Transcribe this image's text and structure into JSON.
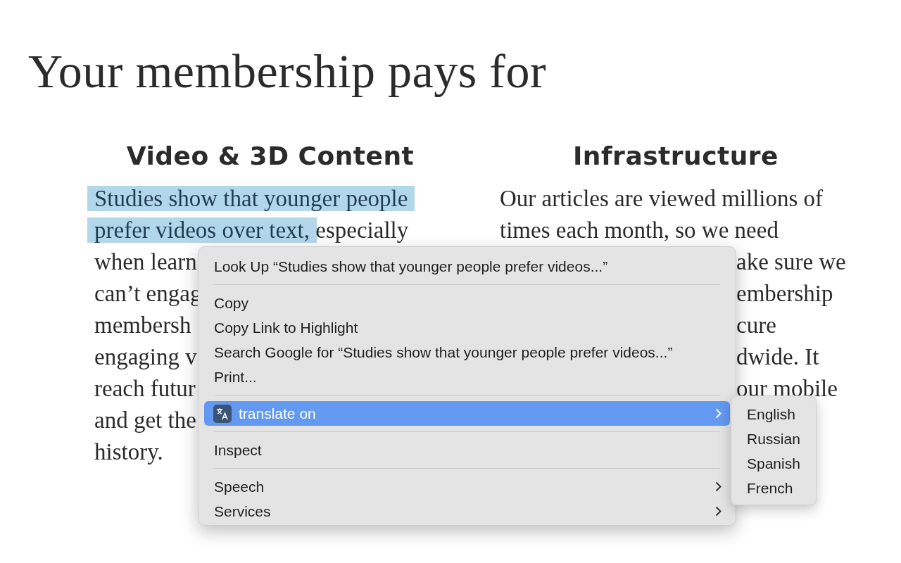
{
  "page": {
    "title": "Your membership pays for",
    "columns": [
      {
        "heading": "Video & 3D Content",
        "lines": [
          {
            "kind": "full",
            "segments": [
              {
                "text": "Studies show that younger people",
                "selected": true
              }
            ]
          },
          {
            "kind": "full",
            "segments": [
              {
                "text": "prefer videos over text,",
                "selected": true
              },
              {
                "text": " especially",
                "selected": false
              }
            ]
          },
          {
            "kind": "full",
            "segments": [
              {
                "text": "when learn",
                "selected": false
              }
            ]
          },
          {
            "kind": "full",
            "segments": [
              {
                "text": "can’t engag",
                "selected": false
              }
            ]
          },
          {
            "kind": "full",
            "segments": [
              {
                "text": "membersh",
                "selected": false
              }
            ]
          },
          {
            "kind": "full",
            "segments": [
              {
                "text": "engaging v",
                "selected": false
              }
            ]
          },
          {
            "kind": "full",
            "segments": [
              {
                "text": "reach futur",
                "selected": false
              }
            ]
          },
          {
            "kind": "full",
            "segments": [
              {
                "text": "and get the",
                "selected": false
              }
            ]
          },
          {
            "kind": "full",
            "segments": [
              {
                "text": "history.",
                "selected": false
              }
            ]
          }
        ]
      },
      {
        "heading": "Infrastructure",
        "lines": [
          {
            "kind": "full",
            "segments": [
              {
                "text": "Our articles are viewed millions of",
                "selected": false
              }
            ]
          },
          {
            "kind": "full",
            "segments": [
              {
                "text": "times each month, so we need",
                "selected": false
              }
            ]
          },
          {
            "kind": "cut",
            "segments": [
              {
                "text": "ake sure we",
                "selected": false
              }
            ]
          },
          {
            "kind": "cut",
            "segments": [
              {
                "text": "embership",
                "selected": false
              }
            ]
          },
          {
            "kind": "cut",
            "segments": [
              {
                "text": "cure",
                "selected": false
              }
            ]
          },
          {
            "kind": "cut",
            "segments": [
              {
                "text": "dwide. It",
                "selected": false
              }
            ]
          },
          {
            "kind": "cut",
            "segments": [
              {
                "text": "our mobile",
                "selected": false
              }
            ]
          }
        ]
      }
    ]
  },
  "context_menu": {
    "items": [
      {
        "kind": "item",
        "label": "Look Up “Studies show that younger people prefer videos...”",
        "selected": false
      },
      {
        "kind": "separator"
      },
      {
        "kind": "item",
        "label": "Copy",
        "selected": false
      },
      {
        "kind": "item",
        "label": "Copy Link to Highlight",
        "selected": false
      },
      {
        "kind": "item",
        "label": "Search Google for “Studies show that younger people prefer videos...”",
        "selected": false
      },
      {
        "kind": "item",
        "label": "Print...",
        "selected": false
      },
      {
        "kind": "separator"
      },
      {
        "kind": "submenu",
        "label": "translate on",
        "selected": true,
        "icon": true
      },
      {
        "kind": "separator"
      },
      {
        "kind": "item",
        "label": "Inspect",
        "selected": false
      },
      {
        "kind": "separator"
      },
      {
        "kind": "submenu",
        "label": "Speech",
        "selected": false
      },
      {
        "kind": "submenu",
        "label": "Services",
        "selected": false
      }
    ],
    "submenu": {
      "items": [
        {
          "label": "English",
          "selected": false
        },
        {
          "label": "Russian",
          "selected": false
        },
        {
          "label": "Spanish",
          "selected": false
        },
        {
          "label": "French",
          "selected": false
        }
      ]
    }
  }
}
